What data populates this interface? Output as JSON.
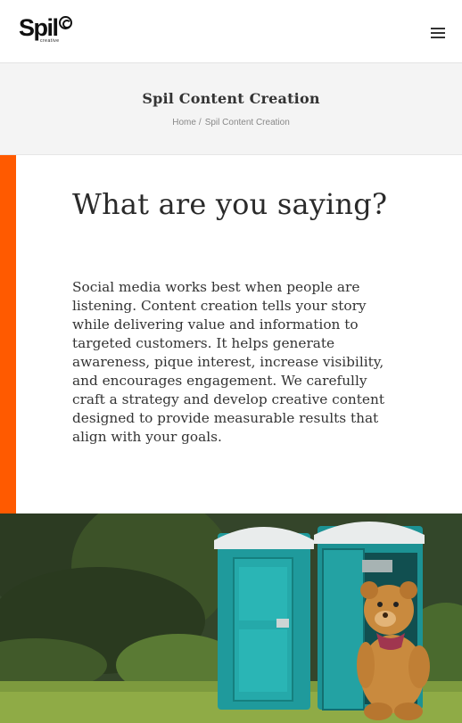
{
  "header": {
    "logo": {
      "word": "Spil",
      "sub": "creative"
    },
    "menu_icon": "hamburger-menu-icon"
  },
  "title_band": {
    "title": "Spil Content Creation",
    "breadcrumb": {
      "home": "Home",
      "separator": "/",
      "current": "Spil Content Creation"
    }
  },
  "content": {
    "heading": "What are you saying?",
    "body": "Social media works best when people are listening. Content creation tells your story while delivering value and information to targeted customers. It helps generate awareness, pique interest, increase visibility, and encourages engagement. We carefully craft a strategy and develop creative content designed to provide measurable results that align with your goals."
  },
  "colors": {
    "accent": "#ff5a00",
    "band_bg": "#f4f4f4",
    "toilet_teal": "#1f9a9c"
  },
  "photo": {
    "subject": "teddy-bear-portable-toilets-image"
  }
}
